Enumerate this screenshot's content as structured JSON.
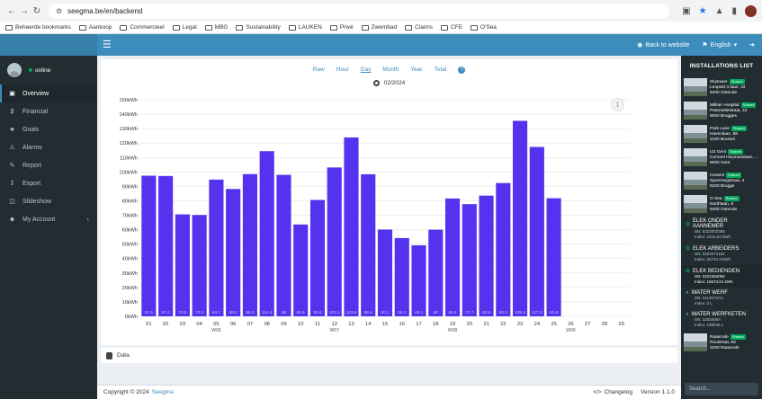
{
  "browser": {
    "url": "seegma.be/en/backend",
    "bookmarks": [
      "Beheerde bookmarks",
      "Aankoop",
      "Commercieel",
      "Legal",
      "MBG",
      "Sustainability",
      "LAUKEN",
      "Privé",
      "Zwembad",
      "Claims",
      "CFE",
      "O'Sea"
    ],
    "avatar_letter": "R"
  },
  "topbar": {
    "back_label": "Back to website",
    "language": "English"
  },
  "sidebar": {
    "status": "online",
    "items": [
      "Overview",
      "Financial",
      "Goals",
      "Alarms",
      "Report",
      "Export",
      "Slideshow",
      "My Account"
    ]
  },
  "period_tabs": [
    "Raw",
    "Hour",
    "Day",
    "Month",
    "Year",
    "Total"
  ],
  "active_period": "Day",
  "current_period": "02/2024",
  "data_section_label": "Data",
  "footer": {
    "copyright": "Copyright © 2024",
    "brand": "Seegma",
    "changelog": "Changelog",
    "version": "Version 1.1.0"
  },
  "installations": {
    "title": "INSTALLATIONS LIST",
    "shared_label": "Shared",
    "items": [
      {
        "name": "Skytower",
        "l2": "Leopold II laan, 33",
        "l3": "8400 Ostende"
      },
      {
        "name": "Militair Hospital",
        "l2": "Peterseliestraat, 23",
        "l3": "8000 Brugges"
      },
      {
        "name": "Park Lane",
        "l2": "Havenlaan, 88",
        "l3": "1020 Brussel"
      },
      {
        "name": "UZ Gent",
        "l2": "Corneel Heymanslaan, ...",
        "l3": "9000 Gent"
      },
      {
        "name": "Howest",
        "l2": "Sporenegstraat, 4",
        "l3": "8200 Brugge"
      },
      {
        "name": "O Sea",
        "l2": "Northlaan, 9",
        "l3": "8400 Ostende"
      }
    ],
    "meters": [
      {
        "name": "ELEK ONDER AANNEMER",
        "sn": "SN: 0222072305",
        "index": "Index: 2415.84 kWh",
        "icon": "leaf",
        "active": false
      },
      {
        "name": "ELEK ARBEIDERS",
        "sn": "SN: 0222074152",
        "index": "Index: 25743.3 kWh",
        "icon": "leaf",
        "active": false
      },
      {
        "name": "ELEK BEDIENDEN",
        "sn": "SN: 0222384092",
        "index": "Index: 16673.61 kWh",
        "icon": "leaf",
        "active": true
      },
      {
        "name": "WATER WERF",
        "sn": "SN: 2112572AC",
        "index": "Index: 0 L",
        "icon": "drop",
        "active": false
      },
      {
        "name": "WATER WERFKETEN",
        "sn": "SN: 2203468A",
        "index": "Index: 199045 L",
        "icon": "drop",
        "active": false
      }
    ],
    "last_item": {
      "name": "Raasrode",
      "l2": "Roostraat, 64",
      "l3": "3200 Raasrode"
    },
    "search_placeholder": "Search..."
  },
  "chart_data": {
    "type": "bar",
    "unit": "kWh",
    "categories": [
      "01",
      "02",
      "03",
      "04",
      "05",
      "06",
      "07",
      "08",
      "09",
      "10",
      "11",
      "12",
      "13",
      "14",
      "15",
      "16",
      "17",
      "18",
      "19",
      "20",
      "21",
      "22",
      "23",
      "24",
      "25",
      "26",
      "27",
      "28",
      "29"
    ],
    "values": [
      97.4,
      97.2,
      70.6,
      70.2,
      94.7,
      88.2,
      98.5,
      114.4,
      98,
      63.6,
      80.6,
      103.1,
      123.9,
      98.4,
      60.1,
      54.2,
      49.2,
      60,
      81.6,
      77.7,
      83.6,
      92.3,
      135.4,
      117.3,
      81.8,
      null,
      null,
      null,
      null
    ],
    "value_labels": [
      "97.4",
      "97.2",
      "70.6",
      "70.2",
      "94.7",
      "88.2",
      "98.5",
      "114.4",
      "98",
      "63.6",
      "80.6",
      "103.1",
      "123.9",
      "98.4",
      "60.1",
      "54.2",
      "49.2",
      "60",
      "81.6",
      "77.7",
      "83.6",
      "92.3",
      "135.4",
      "117.3",
      "81.8"
    ],
    "week_labels": [
      {
        "after": "05",
        "label": "W06"
      },
      {
        "after": "12",
        "label": "W07"
      },
      {
        "after": "19",
        "label": "W08"
      },
      {
        "after": "26",
        "label": "W09"
      }
    ],
    "yticks": [
      "0kWh",
      "10kWh",
      "20kWh",
      "30kWh",
      "40kWh",
      "50kWh",
      "60kWh",
      "70kWh",
      "80kWh",
      "90kWh",
      "100kWh",
      "110kWh",
      "120kWh",
      "130kWh",
      "140kWh",
      "150kWh"
    ],
    "ylim": [
      0,
      150
    ],
    "bar_color": "#5533ee",
    "grid": true
  }
}
